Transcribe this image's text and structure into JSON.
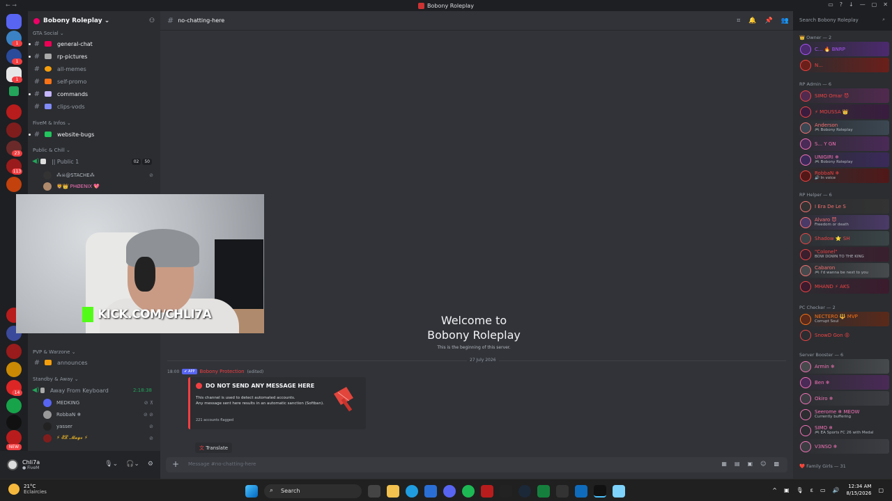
{
  "window": {
    "title": "Bobony Roleplay",
    "nav": "← →"
  },
  "server": {
    "name": "Bobony Roleplay ⌄",
    "guild_badges": [
      "1",
      "1",
      "1",
      "23",
      "113",
      "14",
      "NEW"
    ]
  },
  "categories": {
    "gta_social": "GTA Social ⌄",
    "fivem_infos": "FiveM & Infos ⌄",
    "public_chill": "Public & Chill ⌄",
    "pvp_warzone": "PVP & Warzone ⌄",
    "standby_away": "Standby & Away ⌄"
  },
  "channels": [
    {
      "name": "general-chat",
      "bright": true
    },
    {
      "name": "rp-pictures",
      "bright": true
    },
    {
      "name": "all-memes",
      "bright": false
    },
    {
      "name": "self-promo",
      "bright": false
    },
    {
      "name": "commands",
      "bright": true
    },
    {
      "name": "clips-vods",
      "bright": false
    },
    {
      "name": "website-bugs",
      "bright": true
    },
    {
      "name": "announces",
      "bright": false
    }
  ],
  "voice": {
    "public1": {
      "name": "|| Public 1",
      "count_a": "02",
      "count_b": "50"
    },
    "public1_users": [
      "⁂☠@STACHE⁂",
      "🦁👑 PHØENIX 💖"
    ],
    "afk": {
      "name": "Away From Keyboard",
      "timer": "2:18:38"
    },
    "afk_users": [
      "MEDKING",
      "RobbaN ❄",
      "yasser",
      "⚡ 𝓔𝓛 𝓜𝓪𝓰𝓸 ⚡"
    ]
  },
  "webcam": {
    "kick_text": "KICK.COM/CHLI7A"
  },
  "user": {
    "name": "Chli7a",
    "status": "● FiveM"
  },
  "main": {
    "channel": "no-chatting-here",
    "search_placeholder": "Search Bobony Roleplay",
    "welcome_title": "Welcome to Bobony Roleplay",
    "welcome_sub": "This is the beginning of this server.",
    "date_divider": "27 July 2026",
    "message": {
      "time": "18:00",
      "app_badge": "✔ APP",
      "author": "Bobony Protection",
      "edited": "(edited)",
      "embed_title": "DO NOT SEND ANY MESSAGE HERE",
      "embed_desc_1": "This channel is used to detect automated accounts.",
      "embed_desc_2": "Any message sent here results in an automatic sanction (Softban).",
      "embed_footer": "221 accounts flagged",
      "translate": "Translate"
    },
    "composer_placeholder": "Message #no-chatting-here"
  },
  "members": {
    "owner_cat": "👑 Owner — 2",
    "admin_cat": "RP Admin — 6",
    "helper_cat": "RP Helper — 6",
    "checker_cat": "PC Checker — 2",
    "booster_cat": "Server Booster — 6",
    "family_cat": "❤️ Family Girls — 31",
    "owners": [
      {
        "name": "C... 🔥 BNRP",
        "status": "",
        "color": "#a855f7",
        "bg": "#4c2a6e"
      },
      {
        "name": "N...",
        "status": "",
        "color": "#ef4444",
        "bg": "#6b1f1a"
      }
    ],
    "admins": [
      {
        "name": "SIMO Omar 😈",
        "status": "",
        "color": "#ef4444",
        "bg": "#512a4f"
      },
      {
        "name": "⚡ MOUSSA 👑",
        "status": "",
        "color": "#ef4444",
        "bg": "#3a1c3f"
      },
      {
        "name": "Anderson",
        "status": "🎮 Bobony Roleplay",
        "color": "#f87171",
        "bg": "#3b4752"
      },
      {
        "name": "S... Y GN",
        "status": "",
        "color": "#f472b6",
        "bg": "#4a2a57"
      },
      {
        "name": "UNIGIRI ❄",
        "status": "🎮 Bobony Roleplay",
        "color": "#f472b6",
        "bg": "#3a2a5a"
      },
      {
        "name": "RobbaN ❄",
        "status": "🔊 In voice",
        "color": "#ef4444",
        "bg": "#521818"
      }
    ],
    "helpers": [
      {
        "name": "I Era De Le S",
        "status": "",
        "color": "#f87171",
        "bg": "#333"
      },
      {
        "name": "Alvaro 😈",
        "status": "Freedom or death",
        "color": "#f87171",
        "bg": "#4a3a67"
      },
      {
        "name": "Shadow ⭐ SH",
        "status": "",
        "color": "#ef4444",
        "bg": "#3a4447"
      },
      {
        "name": "\"Colonel\"",
        "status": "BOW DOWN TO THE KING",
        "color": "#ef4444",
        "bg": "#3a1f2e"
      },
      {
        "name": "Cabaron",
        "status": "🎮 I'd wanna be next to you",
        "color": "#f87171",
        "bg": "#474a4c"
      },
      {
        "name": "MHAND ⚡ AKS",
        "status": "",
        "color": "#ef4444",
        "bg": "#3b1b2d"
      }
    ],
    "checkers": [
      {
        "name": "NECTERO 🔱 MVP",
        "status": "Corrupt Soul",
        "color": "#f97316",
        "bg": "#5a2a1a"
      },
      {
        "name": "SnowD Gon 😡",
        "status": "",
        "color": "#ef4444",
        "bg": "#2b2d31"
      }
    ],
    "boosters": [
      {
        "name": "Armin ❄",
        "status": "",
        "color": "#f472b6",
        "bg": "#474a4c"
      },
      {
        "name": "Ben ❄",
        "status": "",
        "color": "#f472b6",
        "bg": "#4a2a57"
      },
      {
        "name": "Okiro ❄",
        "status": "",
        "color": "#f472b6",
        "bg": "#3b3d42"
      },
      {
        "name": "Seerome ❄ MEOW",
        "status": "Currently buffering",
        "color": "#f472b6",
        "bg": "#2b2d31"
      },
      {
        "name": "SIMO ❄",
        "status": "🎮 EA Sports FC 26 with Medal",
        "color": "#f472b6",
        "bg": "#2b2d31"
      },
      {
        "name": "V3NSO ❄",
        "status": "",
        "color": "#f472b6",
        "bg": "#3b3d42"
      }
    ]
  },
  "taskbar": {
    "temp": "21°C",
    "weather": "Eclaircies",
    "search": "Search",
    "time": "12:34 AM",
    "date": "8/15/2026"
  }
}
